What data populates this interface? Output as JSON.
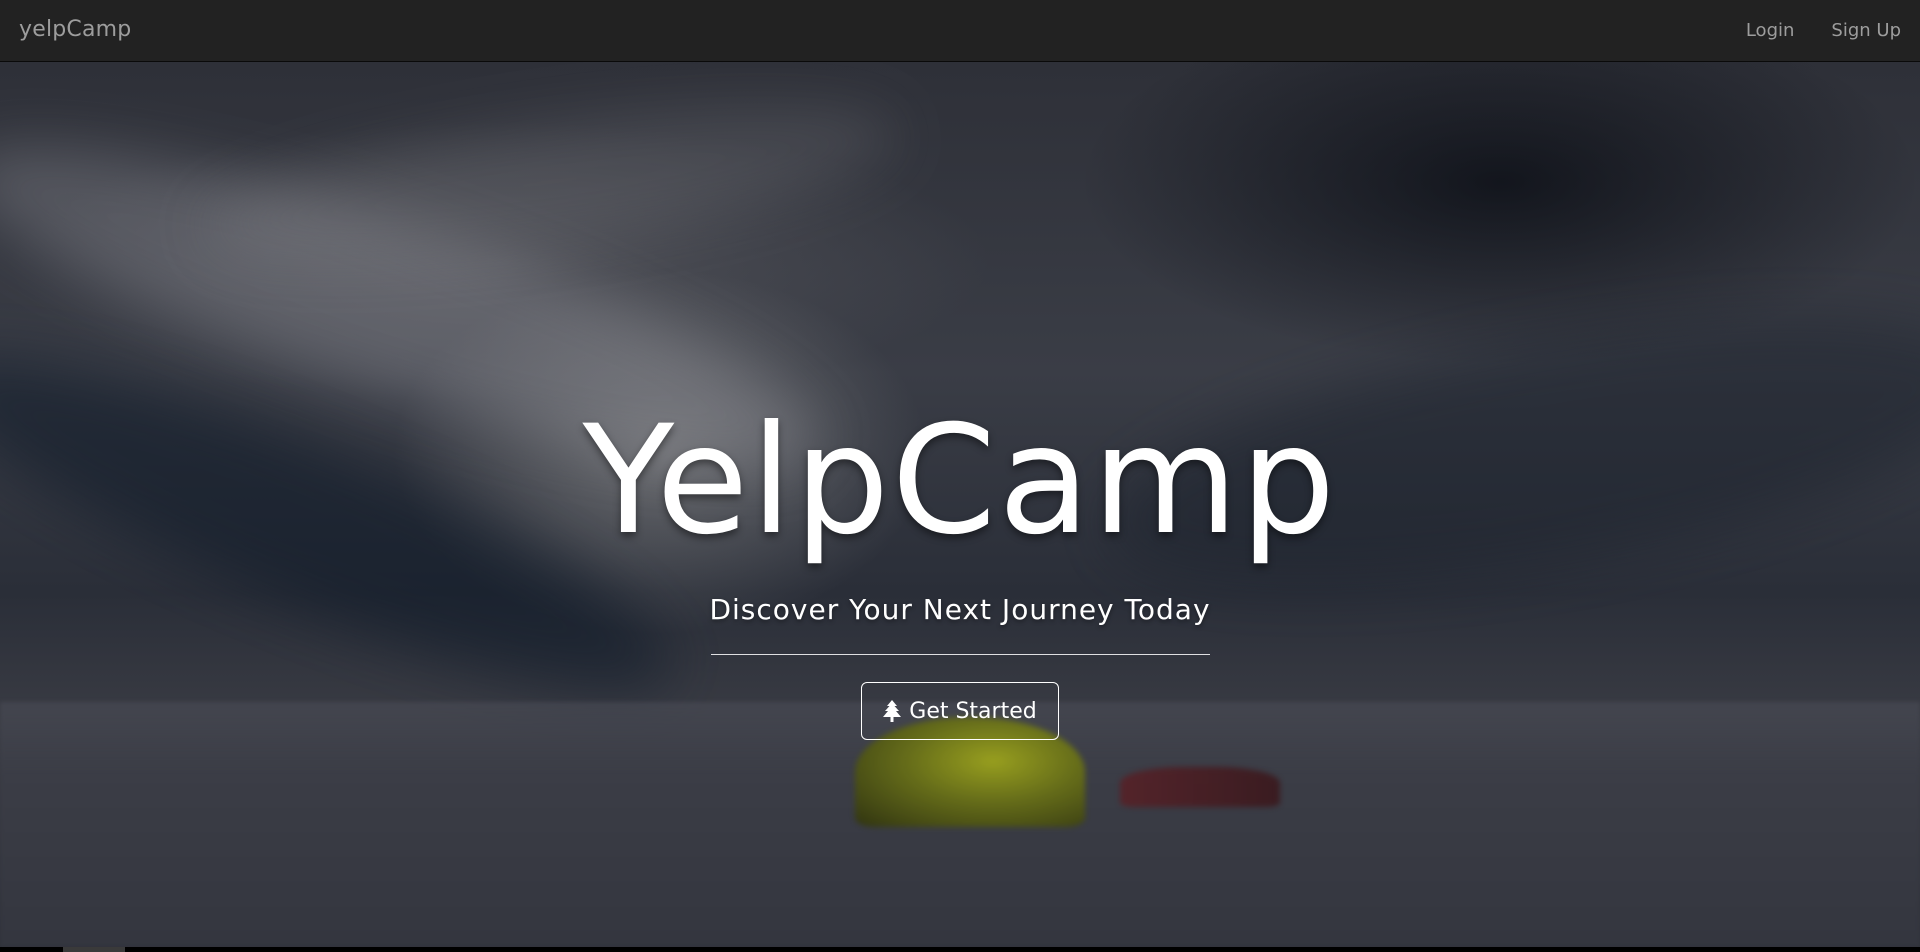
{
  "navbar": {
    "brand": "yelpCamp",
    "links": [
      {
        "label": "Login"
      },
      {
        "label": "Sign Up"
      }
    ],
    "background_color": "#222222",
    "link_color": "#9d9d9d"
  },
  "hero": {
    "title": "YelpCamp",
    "subtitle": "Discover Your Next Journey Today",
    "cta": {
      "label": "Get Started",
      "icon": "tree-icon"
    },
    "text_color": "#ffffff"
  }
}
